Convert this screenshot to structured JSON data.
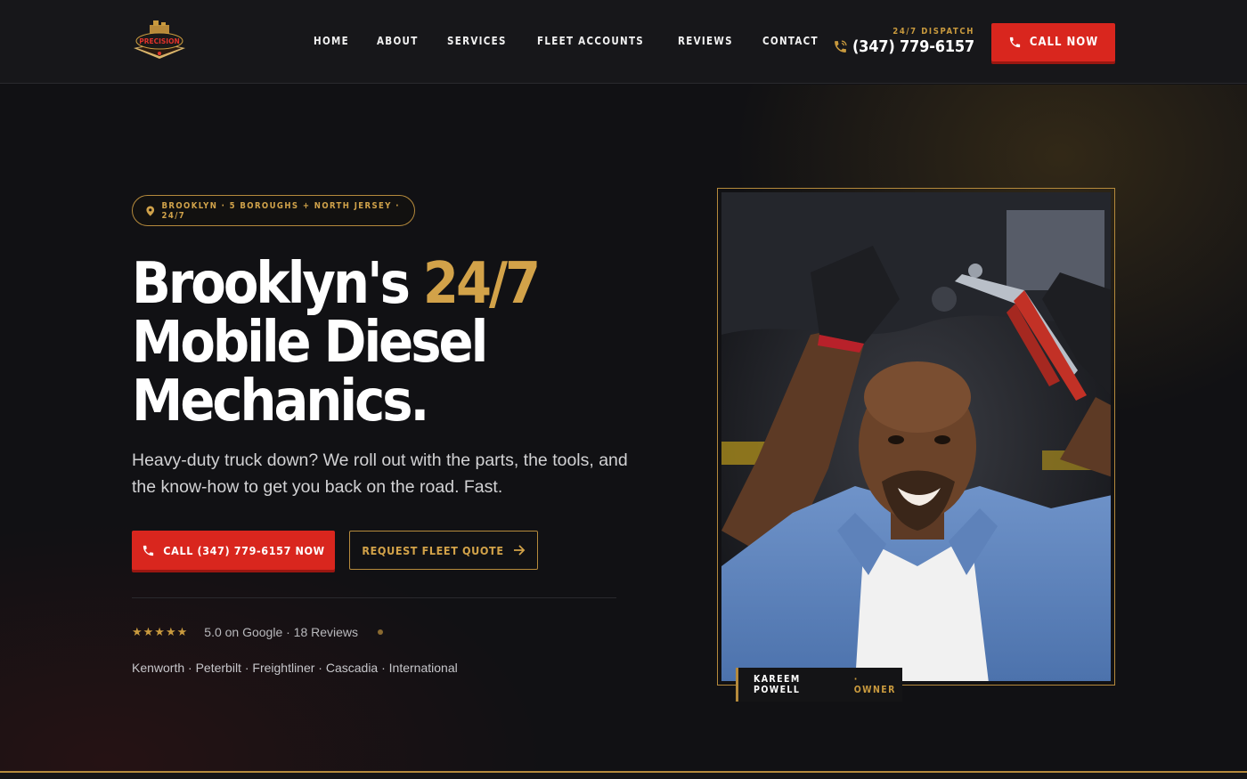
{
  "header": {
    "logo_text": "PRECISION",
    "nav": [
      {
        "label": "HOME"
      },
      {
        "label": "ABOUT"
      },
      {
        "label": "SERVICES"
      },
      {
        "label": "FLEET ACCOUNTS"
      },
      {
        "label": "REVIEWS"
      },
      {
        "label": "CONTACT"
      }
    ],
    "dispatch_label": "24/7 DISPATCH",
    "dispatch_phone": "(347) 779-6157",
    "call_now_label": "CALL NOW"
  },
  "hero": {
    "badge_text": "BROOKLYN · 5 BOROUGHS + NORTH JERSEY · 24/7",
    "headline_part1": "Brooklyn's ",
    "headline_accent": "24/7",
    "headline_line2": "Mobile Diesel",
    "headline_line3": "Mechanics.",
    "subhead": "Heavy-duty truck down? We roll out with the parts, the tools, and the know-how to get you back on the road. Fast.",
    "cta_call_label": "CALL (347) 779-6157 NOW",
    "cta_quote_label": "REQUEST FLEET QUOTE",
    "stars": "★★★★★",
    "rating_text": "5.0 on Google · 18 Reviews",
    "brands": "Kenworth · Peterbilt · Freightliner · Cascadia · International",
    "photo_caption_name": "KAREEM POWELL",
    "photo_caption_role": "· OWNER"
  },
  "colors": {
    "accent_gold": "#c99a3e",
    "cta_red": "#d9261e",
    "background": "#111114"
  }
}
